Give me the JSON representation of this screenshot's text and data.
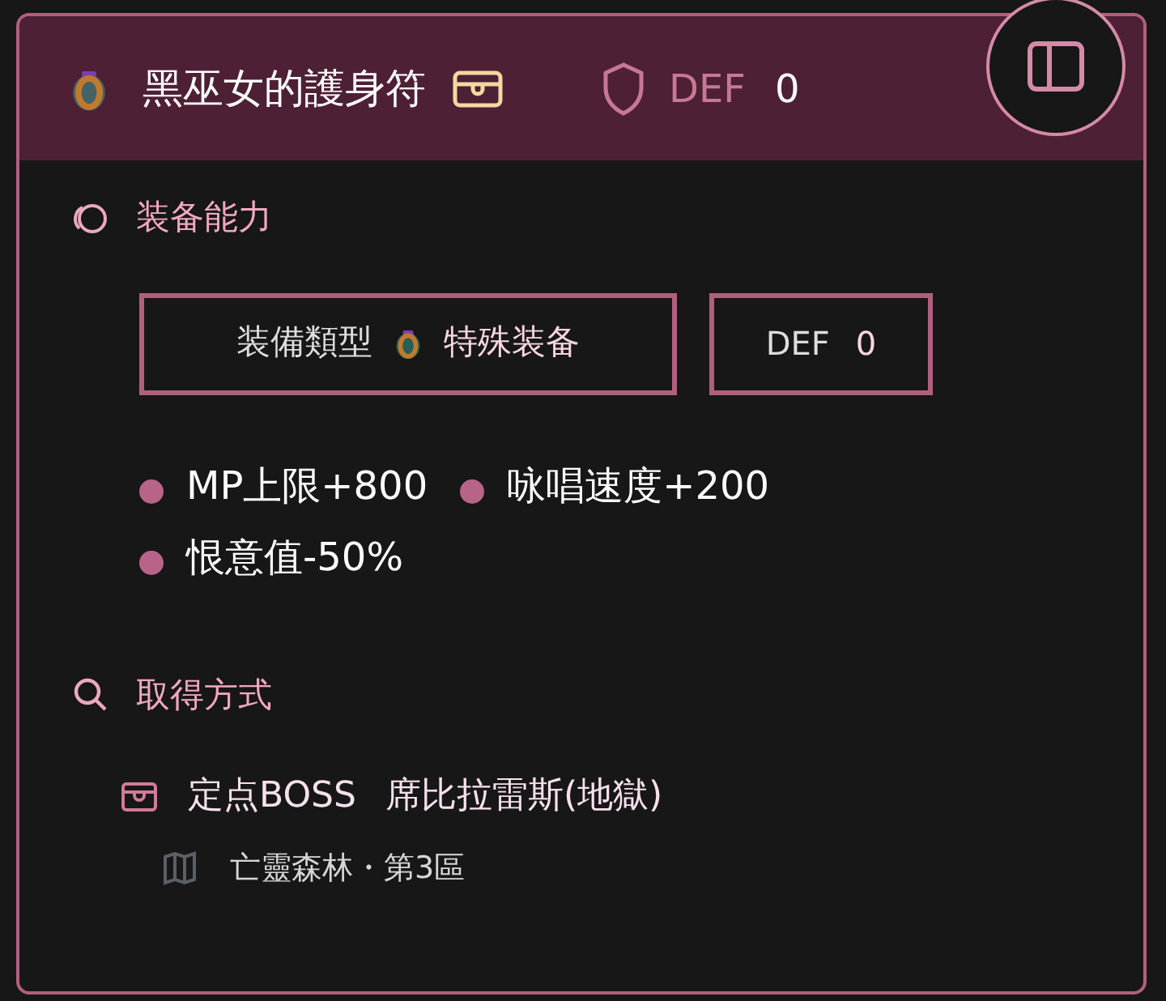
{
  "header": {
    "title": "黑巫女的護身符",
    "stat_label": "DEF",
    "stat_value": "0"
  },
  "ability": {
    "heading": "装备能力",
    "type_label": "装備類型",
    "type_value": "特殊装备",
    "def_label": "DEF",
    "def_value": "0",
    "effects": [
      "MP上限+800",
      "咏唱速度+200",
      "恨意值-50%"
    ]
  },
  "acquire": {
    "heading": "取得方式",
    "sources": [
      {
        "kind": "boss",
        "type": "定点BOSS",
        "name": "席比拉雷斯(地獄)",
        "location": "亡靈森林・第3區"
      }
    ]
  }
}
